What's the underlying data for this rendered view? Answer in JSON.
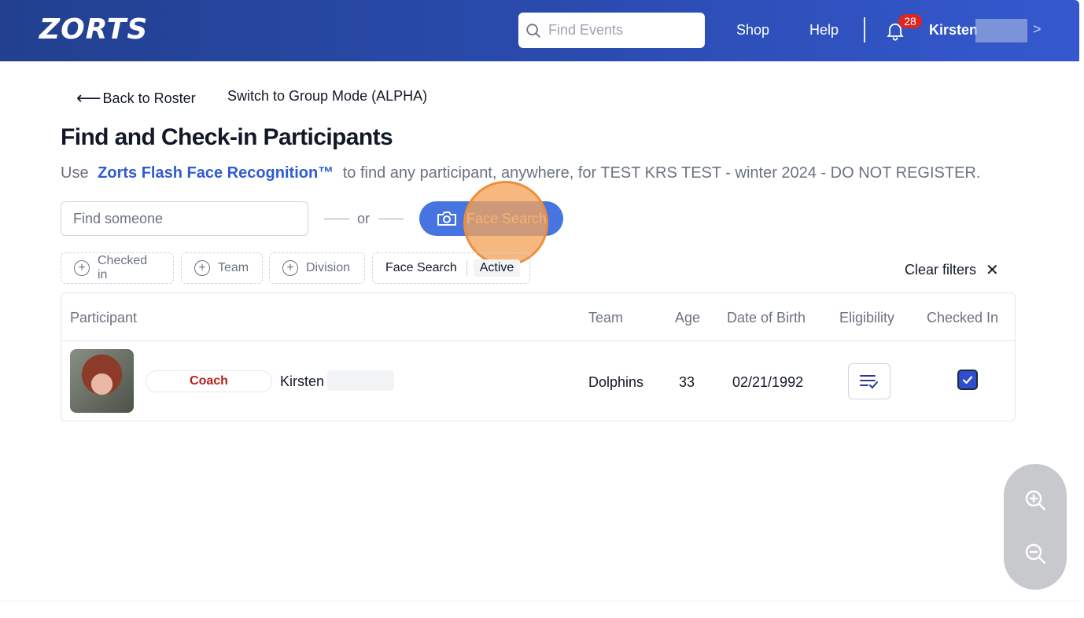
{
  "header": {
    "logo": "ZORTS",
    "search_placeholder": "Find Events",
    "nav": {
      "shop": "Shop",
      "help": "Help"
    },
    "notifications_count": "28",
    "user_name": "Kirsten",
    "chevron": ">"
  },
  "subnav": {
    "back_arrow": "⟵",
    "back_label": "Back to Roster",
    "group_mode": "Switch to Group Mode (ALPHA)"
  },
  "page": {
    "title": "Find and Check-in Participants",
    "subtitle_pre": "Use",
    "subtitle_brand": "Zorts Flash Face Recognition™",
    "subtitle_post": "to find any participant, anywhere, for TEST KRS TEST - winter 2024 - DO NOT REGISTER."
  },
  "search": {
    "placeholder": "Find someone",
    "or_label": "or",
    "face_search_label": "Face Search"
  },
  "filters": {
    "chips": [
      "Checked in",
      "Team",
      "Division"
    ],
    "active": {
      "label": "Face Search",
      "value": "Active"
    },
    "clear_label": "Clear filters",
    "clear_icon": "✕"
  },
  "table": {
    "headers": {
      "participant": "Participant",
      "team": "Team",
      "age": "Age",
      "dob": "Date of Birth",
      "eligibility": "Eligibility",
      "checked_in": "Checked In"
    },
    "rows": [
      {
        "role": "Coach",
        "name": "Kirsten",
        "team": "Dolphins",
        "age": "33",
        "dob": "02/21/1992",
        "checked_in": true
      }
    ]
  },
  "colors": {
    "header_bg": "#2a4cb0",
    "accent": "#4674e0",
    "brand_link": "#2f5bd3",
    "coach_red": "#b91c1c",
    "badge_red": "#dc2626",
    "click_highlight": "#f3a45b"
  },
  "icons": [
    "search-icon",
    "bell-icon",
    "camera-icon",
    "plus-circle-icon",
    "close-icon",
    "eligibility-list-icon",
    "check-icon",
    "zoom-in-icon",
    "zoom-out-icon"
  ]
}
